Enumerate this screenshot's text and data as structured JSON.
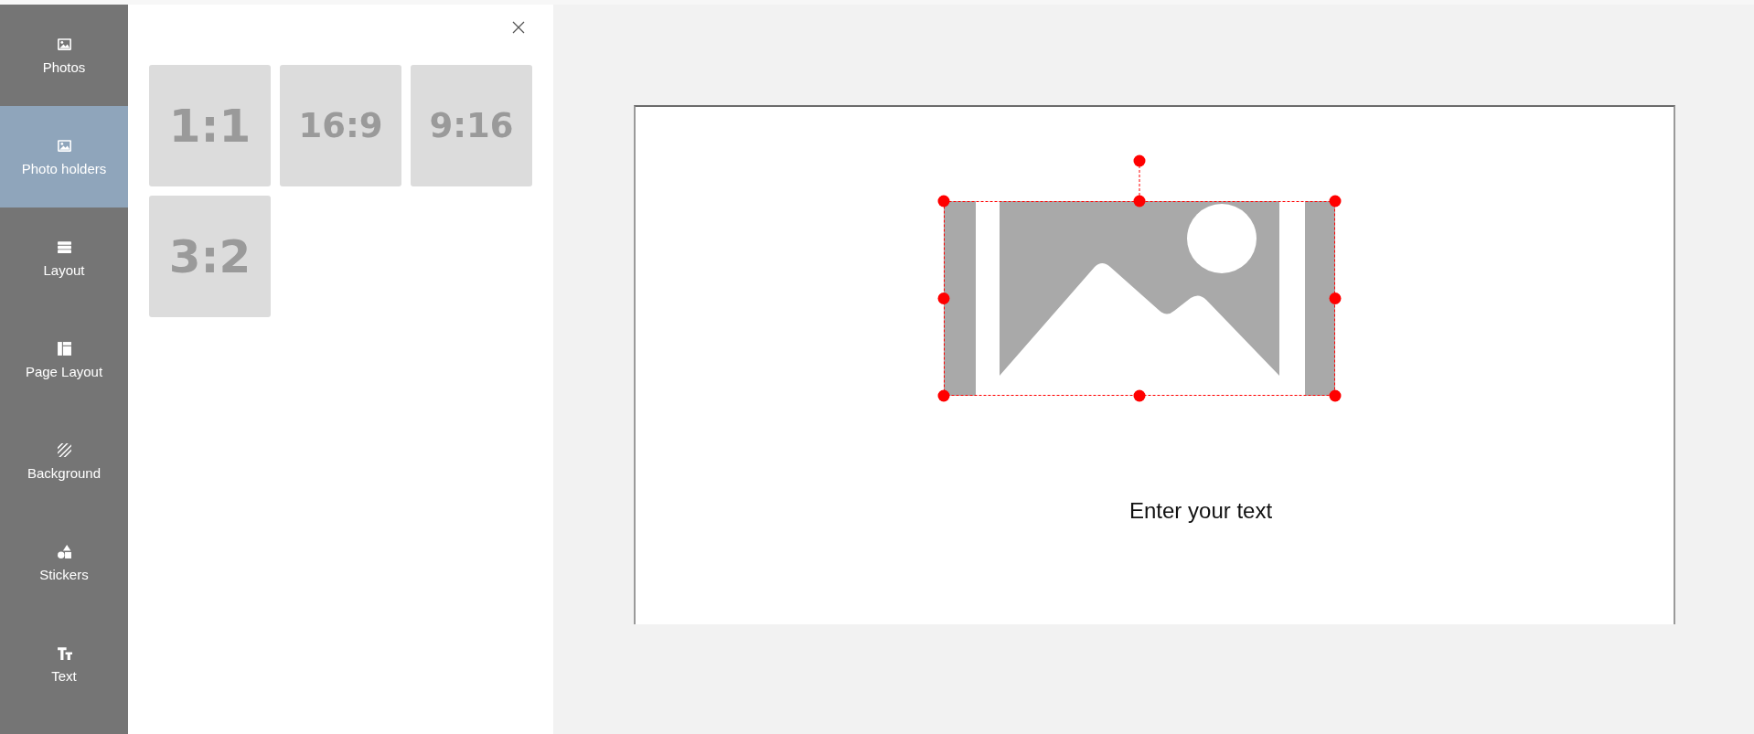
{
  "sidebar": {
    "items": [
      {
        "label": "Photos",
        "selected": false
      },
      {
        "label": "Photo holders",
        "selected": true
      },
      {
        "label": "Layout",
        "selected": false
      },
      {
        "label": "Page Layout",
        "selected": false
      },
      {
        "label": "Background",
        "selected": false
      },
      {
        "label": "Stickers",
        "selected": false
      },
      {
        "label": "Text",
        "selected": false
      }
    ]
  },
  "panel": {
    "ratios": [
      "1:1",
      "16:9",
      "9:16",
      "3:2"
    ]
  },
  "canvas": {
    "photo_holder": {
      "selected": true
    },
    "text": "Enter your text"
  }
}
